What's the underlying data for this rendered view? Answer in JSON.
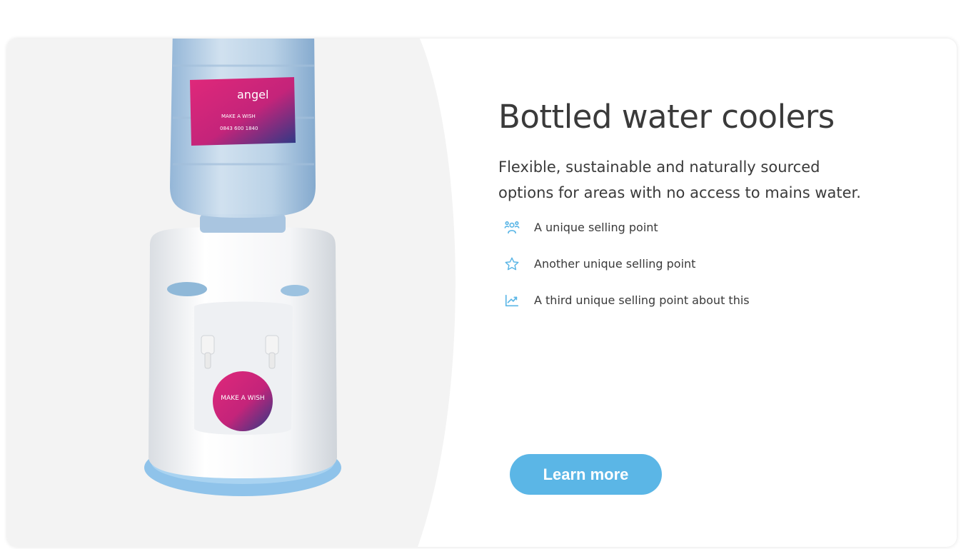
{
  "card": {
    "title": "Bottled water coolers",
    "description_line1": "Flexible, sustainable and naturally sourced",
    "description_line2": "options for areas with no access to mains water.",
    "usps": [
      {
        "icon": "people-icon",
        "label": "A unique selling point"
      },
      {
        "icon": "star-icon",
        "label": "Another unique selling point"
      },
      {
        "icon": "chart-trend-icon",
        "label": "A third unique selling point about this"
      }
    ],
    "button_label": "Learn more",
    "image_alt": "Bottled water cooler dispenser",
    "bottle_label": {
      "brand": "angel",
      "tagline": "MAKE A WISH",
      "phone": "0843 600 1840"
    }
  },
  "colors": {
    "accent": "#5bb6e6",
    "text": "#3a3a3a",
    "panel_bg": "#f3f3f3",
    "label_pink": "#e0287a",
    "label_navy": "#23307a"
  }
}
